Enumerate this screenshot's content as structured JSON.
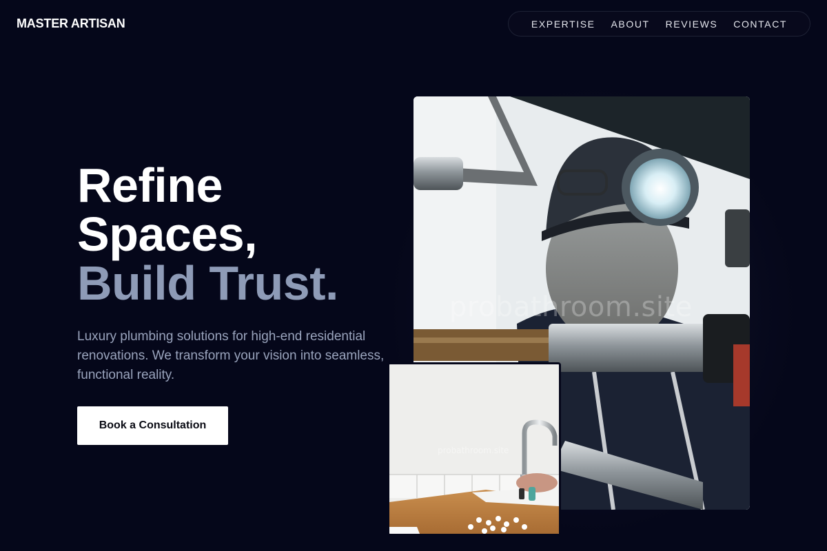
{
  "header": {
    "logo": "MASTER ARTISAN",
    "nav": [
      "EXPERTISE",
      "ABOUT",
      "REVIEWS",
      "CONTACT"
    ]
  },
  "hero": {
    "headline_line1": "Refine",
    "headline_line2": "Spaces,",
    "headline_line3": "Build Trust.",
    "subtext": "Luxury plumbing solutions for high-end residential renovations. We transform your vision into seamless, functional reality.",
    "cta_label": "Book a Consultation"
  },
  "images": {
    "main_watermark": "probathroom.site",
    "secondary_watermark": "probathroom.site"
  },
  "colors": {
    "background": "#05071a",
    "headline_accent": "#8e9bb7",
    "subtext": "#9aa4bd",
    "cta_background": "#ffffff"
  }
}
